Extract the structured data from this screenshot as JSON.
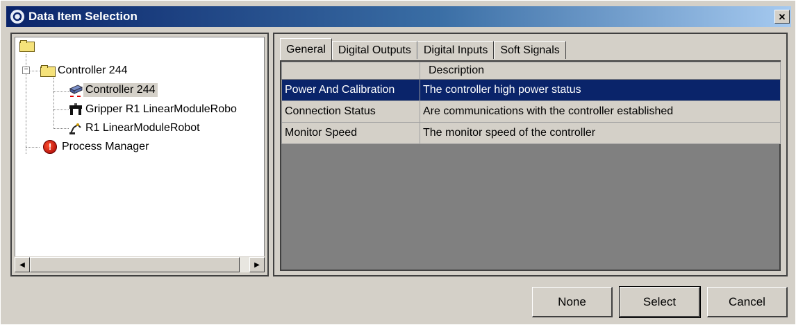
{
  "window": {
    "title": "Data Item Selection",
    "close_glyph": "✕"
  },
  "tree": {
    "nodes": [
      {
        "label": "",
        "icon": "folder-icon"
      },
      {
        "label": "Controller 244",
        "icon": "folder-icon"
      },
      {
        "label": "Controller 244",
        "icon": "controller-icon",
        "selected": true
      },
      {
        "label": "Gripper R1 LinearModuleRobo",
        "icon": "gripper-icon"
      },
      {
        "label": "R1 LinearModuleRobot",
        "icon": "robot-icon"
      },
      {
        "label": "Process Manager",
        "icon": "process-manager-icon"
      }
    ],
    "expander_glyph": "−"
  },
  "tabs": [
    {
      "label": "General",
      "active": true
    },
    {
      "label": "Digital Outputs"
    },
    {
      "label": "Digital Inputs"
    },
    {
      "label": "Soft Signals"
    }
  ],
  "grid": {
    "header": {
      "name": "",
      "description": "Description"
    },
    "rows": [
      {
        "name": "Power And Calibration",
        "description": "The controller high power status",
        "selected": true
      },
      {
        "name": "Connection Status",
        "description": "Are communications with the controller established"
      },
      {
        "name": "Monitor Speed",
        "description": "The monitor speed of the controller"
      }
    ]
  },
  "buttons": {
    "none": "None",
    "select": "Select",
    "cancel": "Cancel"
  },
  "scroll": {
    "left": "◀",
    "right": "▶"
  },
  "colors": {
    "titlebar": "#0a246a",
    "selection": "#0a246a",
    "face": "#d4d0c8",
    "grid_bg": "#808080"
  }
}
